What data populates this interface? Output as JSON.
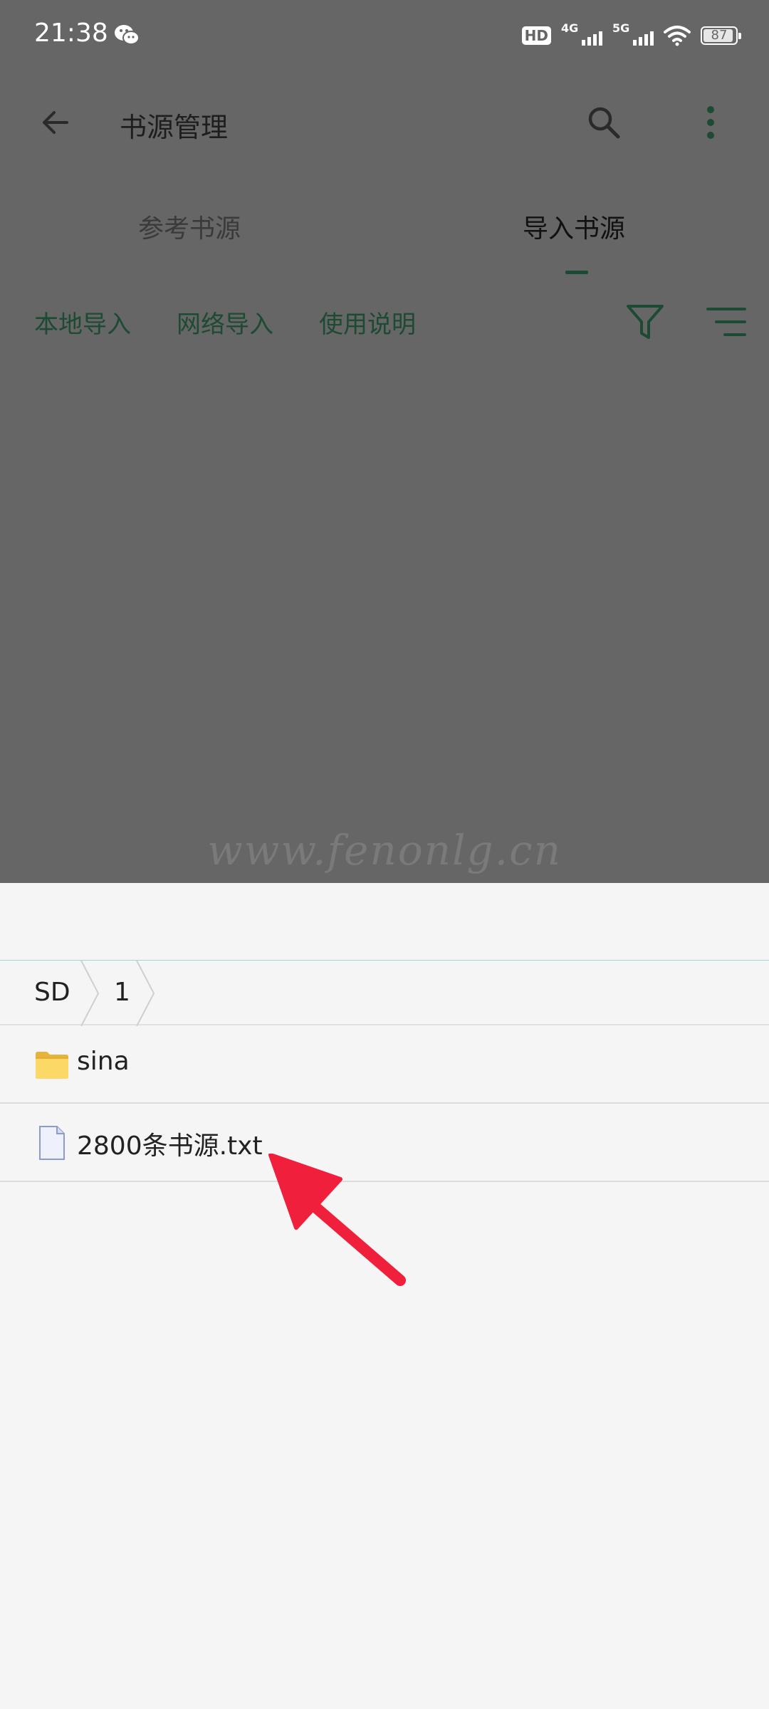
{
  "status_bar": {
    "time": "21:38",
    "hd_badge": "HD",
    "network1": "4G",
    "network2": "5G",
    "battery": "87"
  },
  "toolbar": {
    "title": "书源管理"
  },
  "tabs": [
    {
      "label": "参考书源"
    },
    {
      "label": "导入书源"
    }
  ],
  "actions": {
    "local_import": "本地导入",
    "network_import": "网络导入",
    "instructions": "使用说明"
  },
  "watermark": "www.fenonlg.cn",
  "file_picker": {
    "breadcrumb": [
      "SD",
      "1"
    ],
    "items": [
      {
        "name": "sina",
        "type": "folder"
      },
      {
        "name": "2800条书源.txt",
        "type": "file"
      }
    ]
  },
  "icons": {
    "back": "arrow-left-icon",
    "search": "search-icon",
    "more": "more-vertical-icon",
    "filter": "filter-icon",
    "sort": "sort-lines-icon",
    "folder": "folder-icon",
    "file": "file-icon",
    "pointer": "red-arrow-icon"
  },
  "colors": {
    "accent": "#1d4a32",
    "dim_overlay": "#666666",
    "sheet_bg": "#f5f5f5",
    "annotation_arrow": "#f0203c"
  }
}
